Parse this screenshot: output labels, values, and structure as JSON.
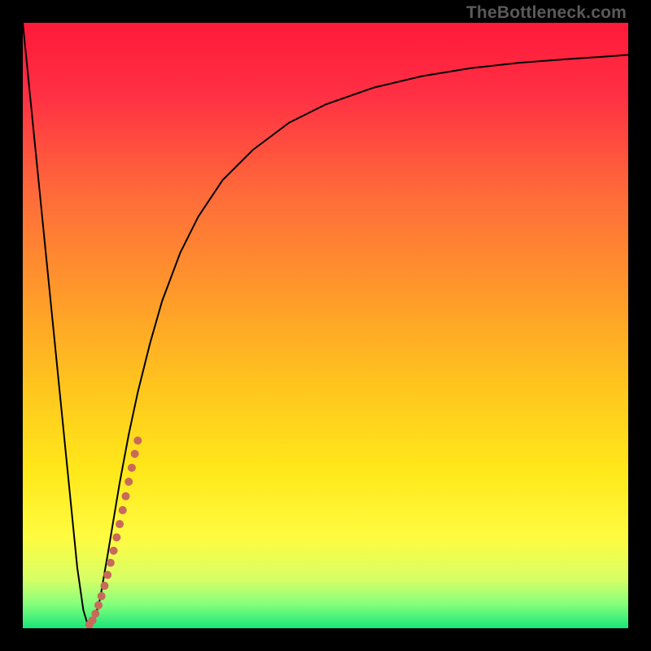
{
  "watermark": "TheBottleneck.com",
  "chart_data": {
    "type": "line",
    "title": "",
    "xlabel": "",
    "ylabel": "",
    "xlim": [
      0,
      100
    ],
    "ylim": [
      0,
      100
    ],
    "grid": false,
    "legend": false,
    "background_gradient": {
      "orientation": "vertical",
      "stops": [
        {
          "pos": 0.0,
          "color": "#ff1a3a"
        },
        {
          "pos": 0.12,
          "color": "#ff3044"
        },
        {
          "pos": 0.28,
          "color": "#ff6a3a"
        },
        {
          "pos": 0.45,
          "color": "#ff9a2a"
        },
        {
          "pos": 0.6,
          "color": "#ffc51e"
        },
        {
          "pos": 0.74,
          "color": "#ffe81a"
        },
        {
          "pos": 0.85,
          "color": "#fffb40"
        },
        {
          "pos": 0.92,
          "color": "#d6ff66"
        },
        {
          "pos": 0.96,
          "color": "#86ff7a"
        },
        {
          "pos": 1.0,
          "color": "#18e67a"
        }
      ]
    },
    "annotations": [
      {
        "text": "TheBottleneck.com",
        "position": "top-right",
        "color": "#5a5a5a"
      }
    ],
    "series": [
      {
        "name": "bottleneck-curve",
        "stroke": "#000000",
        "stroke_width": 2,
        "x": [
          0.0,
          1.5,
          3.0,
          4.5,
          6.0,
          7.5,
          9.0,
          10.0,
          10.6,
          11.0,
          11.3,
          11.7,
          12.0,
          12.8,
          13.3,
          14.0,
          15.0,
          16.0,
          17.5,
          19.0,
          21.0,
          23.0,
          26.0,
          29.0,
          33.0,
          38.0,
          44.0,
          50.0,
          58.0,
          66.0,
          74.0,
          82.0,
          90.0,
          96.0,
          100.0
        ],
        "y": [
          100.0,
          85.0,
          70.0,
          55.0,
          40.0,
          25.0,
          10.0,
          3.0,
          1.0,
          0.5,
          0.5,
          1.0,
          2.0,
          5.0,
          8.0,
          12.0,
          18.0,
          24.0,
          32.0,
          39.0,
          47.0,
          54.0,
          62.0,
          68.0,
          74.0,
          79.0,
          83.5,
          86.5,
          89.3,
          91.2,
          92.5,
          93.4,
          94.0,
          94.4,
          94.7
        ]
      },
      {
        "name": "highlight-region",
        "type": "scatter",
        "stroke": "#c86a5a",
        "fill": "#c86a5a",
        "marker": "circle",
        "marker_radius": 5,
        "x": [
          11.0,
          11.5,
          12.0,
          12.5,
          13.0,
          13.5,
          14.0,
          14.5,
          15.0,
          15.5,
          16.0,
          16.5,
          17.0,
          17.5,
          18.0,
          18.5,
          19.0
        ],
        "y": [
          0.6,
          1.3,
          2.4,
          3.8,
          5.3,
          7.0,
          8.8,
          10.8,
          12.8,
          15.0,
          17.2,
          19.5,
          21.8,
          24.2,
          26.5,
          28.8,
          31.0
        ]
      }
    ]
  }
}
